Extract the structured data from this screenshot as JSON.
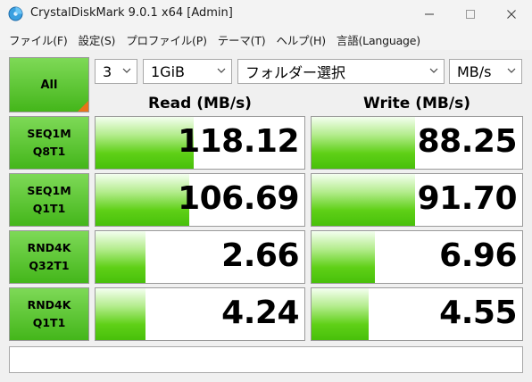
{
  "window": {
    "title": "CrystalDiskMark 9.0.1 x64 [Admin]"
  },
  "menu": [
    "ファイル(F)",
    "設定(S)",
    "プロファイル(P)",
    "テーマ(T)",
    "ヘルプ(H)",
    "言語(Language)"
  ],
  "controls": {
    "all_label": "All",
    "count": "3",
    "size": "1GiB",
    "folder": "フォルダー選択",
    "unit": "MB/s"
  },
  "headers": {
    "read": "Read (MB/s)",
    "write": "Write (MB/s)"
  },
  "colors": {
    "label_green": "#44b61a",
    "bar_green": "#5fd017",
    "accent_orange": "#e8731a"
  },
  "rows": [
    {
      "line1": "SEQ1M",
      "line2": "Q8T1",
      "read": "118.12",
      "write": "88.25",
      "read_level": 0.47,
      "write_level": 0.49
    },
    {
      "line1": "SEQ1M",
      "line2": "Q1T1",
      "read": "106.69",
      "write": "91.70",
      "read_level": 0.45,
      "write_level": 0.49
    },
    {
      "line1": "RND4K",
      "line2": "Q32T1",
      "read": "2.66",
      "write": "6.96",
      "read_level": 0.24,
      "write_level": 0.3
    },
    {
      "line1": "RND4K",
      "line2": "Q1T1",
      "read": "4.24",
      "write": "4.55",
      "read_level": 0.24,
      "write_level": 0.27
    }
  ],
  "comment": ""
}
